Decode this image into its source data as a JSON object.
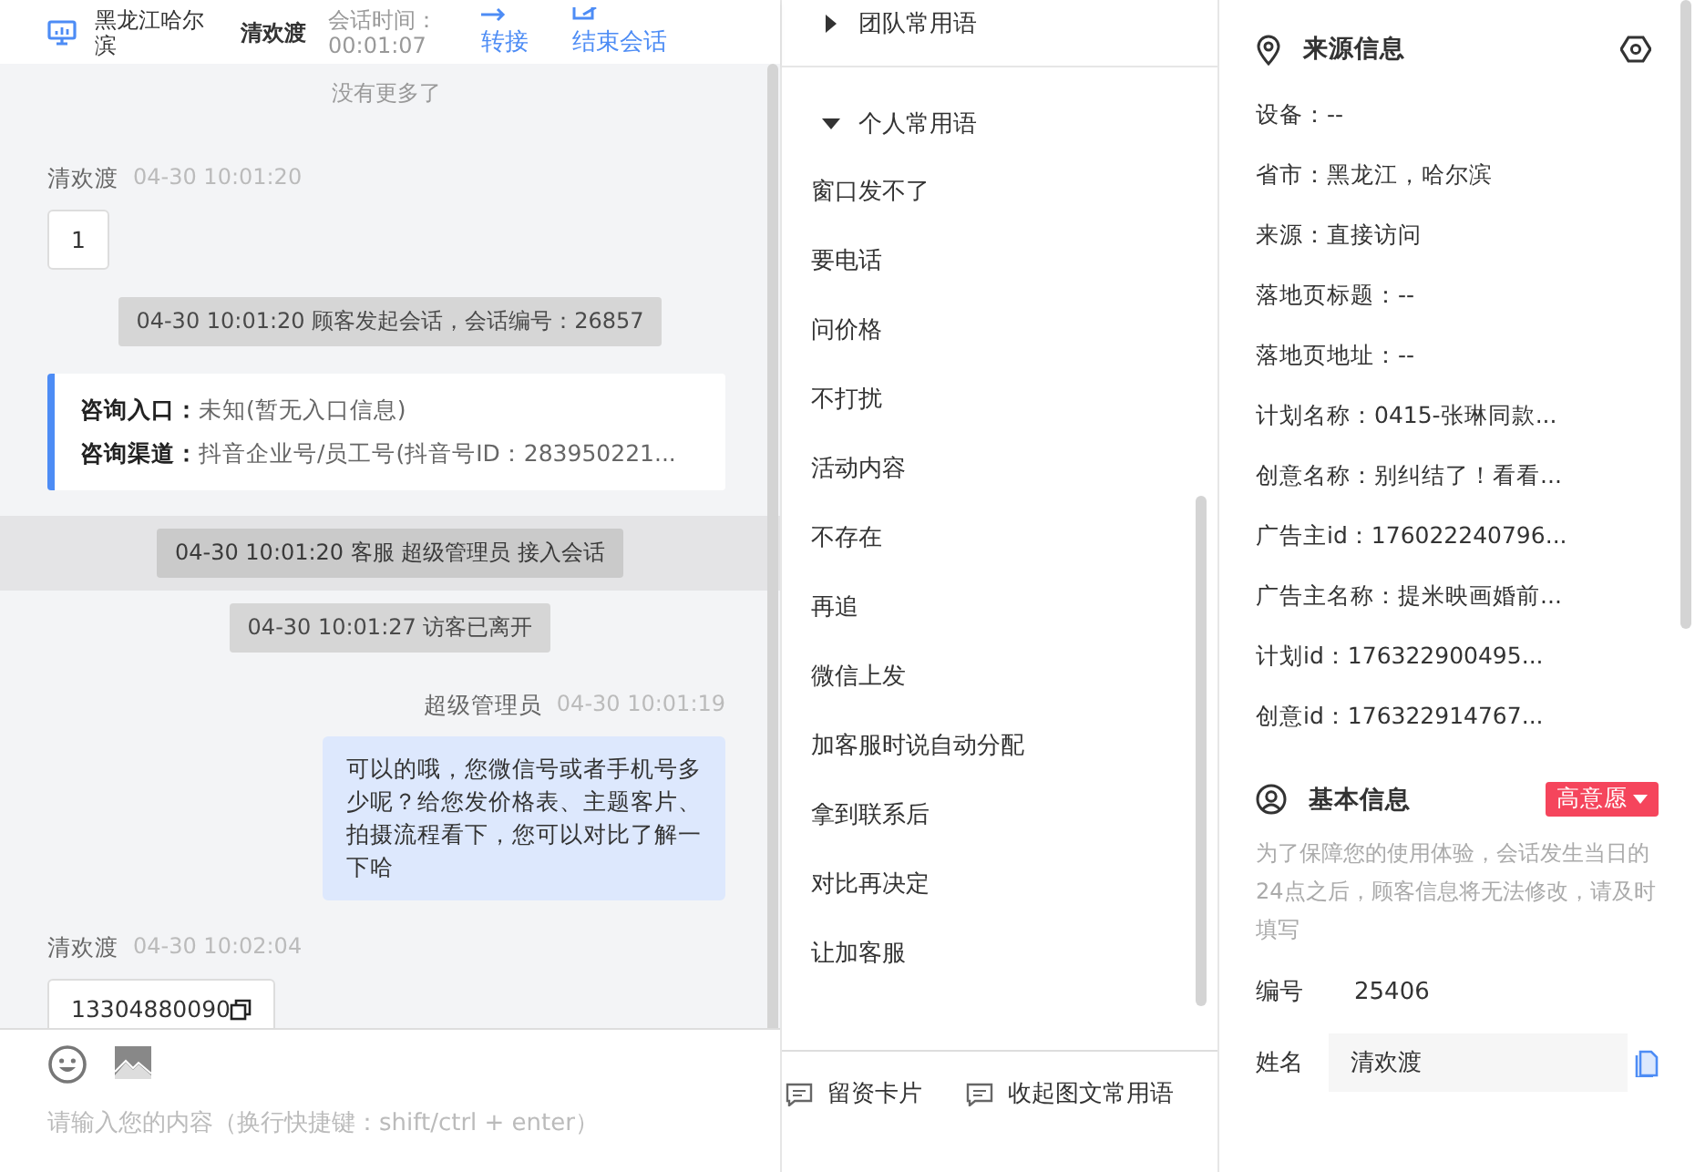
{
  "header": {
    "location": "黑龙江哈尔滨",
    "name": "清欢渡",
    "duration_label": "会话时间：",
    "duration": "00:01:07",
    "actions": [
      {
        "kind": "transfer",
        "label": "转接"
      },
      {
        "kind": "end",
        "label": "结束会话"
      }
    ]
  },
  "messages": [
    {
      "kind": "notice",
      "text": "没有更多了"
    },
    {
      "kind": "customer",
      "sender": "清欢渡",
      "time": "04-30 10:01:20",
      "text": "1",
      "copyable": false
    },
    {
      "kind": "system",
      "text": "04-30 10:01:20 顾客发起会话，会话编号：26857",
      "highlighted": false
    },
    {
      "kind": "info",
      "rows": [
        {
          "label": "咨询入口：",
          "value": "未知(暂无入口信息)"
        },
        {
          "label": "咨询渠道：",
          "value": "抖音企业号/员工号(抖音号ID：283950221..."
        }
      ]
    },
    {
      "kind": "system",
      "text": "04-30 10:01:20 客服 超级管理员 接入会话",
      "highlighted": true
    },
    {
      "kind": "system",
      "text": "04-30 10:01:27 访客已离开",
      "highlighted": false
    },
    {
      "kind": "agent",
      "sender": "超级管理员",
      "time": "04-30 10:01:19",
      "text": "可以的哦，您微信号或者手机号多少呢？给您发价格表、主题客片、拍摄流程看下，您可以对比了解一下哈"
    },
    {
      "kind": "customer",
      "sender": "清欢渡",
      "time": "04-30 10:02:04",
      "text": "13304880090",
      "copyable": true
    }
  ],
  "composer": {
    "tools": [
      {
        "kind": "emoji"
      },
      {
        "kind": "image"
      }
    ],
    "actions": [
      "留资卡片",
      "收起图文常用语"
    ],
    "placeholder": "请输入您的内容（换行快捷键：shift/ctrl + enter）"
  },
  "phrases": [
    {
      "label": "团队常用语",
      "expanded": false
    },
    {
      "label": "个人常用语",
      "expanded": true,
      "items": [
        "窗口发不了",
        "要电话",
        "问价格",
        "不打扰",
        "活动内容",
        "不存在",
        "再追",
        "微信上发",
        "加客服时说自动分配",
        "拿到联系后",
        "对比再决定",
        "让加客服"
      ]
    }
  ],
  "source_info": {
    "title": "来源信息",
    "rows": [
      "设备：--",
      "省市：黑龙江，哈尔滨",
      "来源：直接访问",
      "落地页标题：--",
      "落地页地址：--",
      "计划名称：0415-张琳同款...",
      "创意名称：别纠结了！看看...",
      "广告主id：176022240796...",
      "广告主名称：提米映画婚前...",
      "计划id：176322900495...",
      "创意id：176322914767..."
    ]
  },
  "basic_info": {
    "title": "基本信息",
    "intent": "高意愿",
    "note": "为了保障您的使用体验，会话发生当日的24点之后，顾客信息将无法修改，请及时填写",
    "fields": [
      {
        "kind": "text",
        "label": "编号",
        "value": "25406"
      },
      {
        "kind": "input",
        "label": "姓名",
        "value": "清欢渡"
      }
    ]
  }
}
